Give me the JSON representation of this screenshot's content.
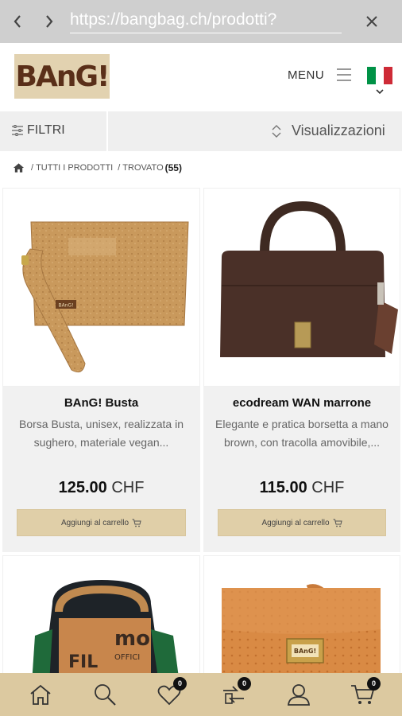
{
  "browser": {
    "url": "https://bangbag.ch/prodotti?",
    "icons": {
      "back": "chevron-left-icon",
      "forward": "chevron-right-icon",
      "close": "close-icon"
    }
  },
  "header": {
    "logo_text": "BAnG!",
    "menu_label": "MENU",
    "language_flag": "italy-flag-icon",
    "colors": {
      "logo_bg": "#e2d2b0",
      "logo_text": "#5a2f19",
      "flag": [
        "#009246",
        "#ffffff",
        "#ce2b37"
      ]
    }
  },
  "filters": {
    "filter_label": "FILTRI",
    "views_label": "Visualizzazioni"
  },
  "breadcrumb": {
    "home_icon": "home-icon",
    "items": [
      "TUTTI I PRODOTTI",
      "TROVATO"
    ],
    "count": "(55)"
  },
  "products": [
    {
      "name": "BAnG! Busta",
      "description": "Borsa Busta, unisex, realizzata in sughero, materiale vegan...",
      "price": "125.00",
      "currency": "CHF",
      "button": "Aggiungi al carrello"
    },
    {
      "name": "ecodream WAN marrone",
      "description": "Elegante e pratica borsetta a mano brown, con tracolla amovibile,...",
      "price": "115.00",
      "currency": "CHF",
      "button": "Aggiungi al carrello"
    },
    {
      "image_icon": "tote-bag-image"
    },
    {
      "image_icon": "orange-handbag-image"
    }
  ],
  "product_image_labels": {
    "busta_tag": "BAnG!",
    "bag3_print_1": "mo",
    "bag3_print_2": "OFFICI",
    "bag3_print_3": "FIL",
    "bag4_clasp": "BAnG!"
  },
  "bottom_nav": {
    "items": [
      {
        "icon": "home-icon"
      },
      {
        "icon": "search-icon"
      },
      {
        "icon": "heart-icon",
        "badge": "0"
      },
      {
        "icon": "compare-icon",
        "badge": "0"
      },
      {
        "icon": "user-icon"
      },
      {
        "icon": "cart-icon",
        "badge": "0"
      }
    ],
    "accent": "#dcc9a0"
  }
}
